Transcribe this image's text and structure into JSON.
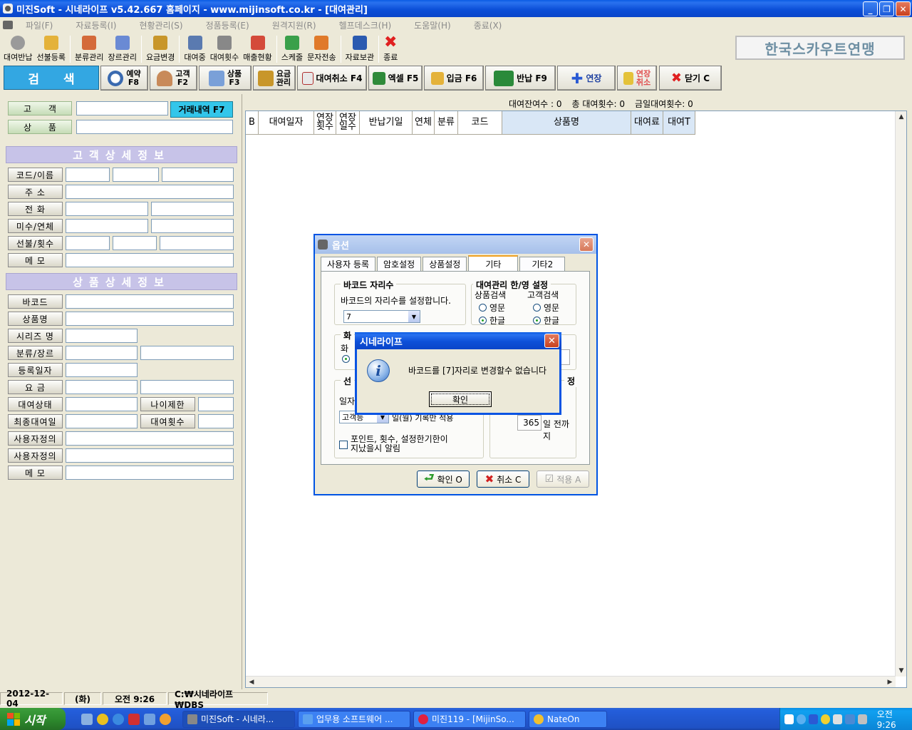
{
  "window": {
    "title": "미진Soft - 시네라이프 v5.42.667 홈페이지 - www.mijinsoft.co.kr - [대여관리]"
  },
  "menu": [
    "파일(F)",
    "자료등록(I)",
    "현황관리(S)",
    "정품등록(E)",
    "원격지원(R)",
    "헬프데스크(H)",
    "도움말(H)",
    "종료(X)"
  ],
  "toolbar": [
    {
      "label": "대여반납",
      "icon": "cd-icon",
      "color": "#9a9a9a"
    },
    {
      "label": "선불등록",
      "icon": "crown-icon",
      "color": "#e4b23a"
    },
    {
      "label": "분류관리",
      "icon": "notepad-icon",
      "color": "#d46a3a"
    },
    {
      "label": "장르관리",
      "icon": "notepad-pen-icon",
      "color": "#6a8ad4"
    },
    {
      "label": "요금변경",
      "icon": "coins-icon",
      "color": "#c8962a"
    },
    {
      "label": "대여중",
      "icon": "magnifier-icon",
      "color": "#5a7ab0"
    },
    {
      "label": "대여횟수",
      "icon": "list-icon",
      "color": "#888888"
    },
    {
      "label": "매출현황",
      "icon": "bar-chart-icon",
      "color": "#d44a3a"
    },
    {
      "label": "스케줄",
      "icon": "calendar-icon",
      "color": "#3aa04a"
    },
    {
      "label": "문자전송",
      "icon": "phone-icon",
      "color": "#e07a2a"
    },
    {
      "label": "자료보관",
      "icon": "floppy-icon",
      "color": "#2a5ab0"
    },
    {
      "label": "종료",
      "icon": "red-x-icon",
      "color": "#e02020"
    }
  ],
  "brand": "한국스카우트연맹",
  "actions": {
    "search": "검 색",
    "reserve": "예약 F8",
    "reserve_a": "예약",
    "reserve_b": "F8",
    "customer_a": "고객",
    "customer_b": "F2",
    "product_a": "상품",
    "product_b": "F3",
    "fee_a": "요금",
    "fee_b": "관리",
    "cancel_rent": "대여취소 F4",
    "excel": "엑셀 F5",
    "deposit": "입금 F6",
    "return": "반납 F9",
    "extend": "연장",
    "ext_cancel_a": "연장",
    "ext_cancel_b": "취소",
    "close": "닫기 C"
  },
  "search": {
    "customer_label": "고 객",
    "product_label": "상 품",
    "history_button": "거래내역 F7"
  },
  "customer_section": {
    "title": "고객상세정보",
    "fields": [
      "코드/이름",
      "주 소",
      "전 화",
      "미수/연체",
      "선불/횟수",
      "메 모"
    ]
  },
  "product_section": {
    "title": "상품상세정보",
    "fields": [
      "바코드",
      "상품명",
      "시리즈 명",
      "분류/장르",
      "등록일자",
      "요 금",
      "대여상태",
      "최종대여일",
      "사용자정의",
      "사용자정의",
      "메 모"
    ],
    "age_limit": "나이제한",
    "rent_count": "대여횟수"
  },
  "counts": {
    "remaining": "대여잔여수 : 0",
    "total": "총 대여횟수: 0",
    "today": "금일대여횟수: 0"
  },
  "grid": {
    "columns": [
      "B",
      "대여일자",
      "연장\n횟수",
      "연장\n일수",
      "반납기일",
      "연체",
      "분류",
      "코드",
      "상품명",
      "대여료",
      "대여T"
    ]
  },
  "status": {
    "date": "2012-12-04",
    "weekday": "(화)",
    "time": "오전 9:26",
    "path": "C:₩시네라이프₩DBS"
  },
  "options_dialog": {
    "title": "옵션",
    "tabs": [
      "사용자 등록",
      "암호설정",
      "상품설정",
      "기타",
      "기타2"
    ],
    "barcode_group": "바코드 자리수",
    "barcode_desc": "바코드의 자리수를 설정합니다.",
    "barcode_value": "7",
    "lang_group": "대여관리 한/영 설정",
    "product_search": "상품검색",
    "customer_search": "고객검색",
    "eng": "영문",
    "kor": "한글",
    "screen_group_frag": "화",
    "screen_sub_frag": "화",
    "prepay_frag": "선",
    "date_frag": "일자",
    "combo_frag": "고객등",
    "combo_suffix": "일(월) 기록만 적용",
    "points_line1": "포인트,  횟수,  설정한기한이",
    "points_line2": "지났을시 알림",
    "days_value": "365",
    "days_suffix": "일 전까지",
    "right_group_frag": "정",
    "ok": "확인 O",
    "cancel": "취소 C",
    "apply": "적용 A"
  },
  "msgbox": {
    "title": "시네라이프",
    "message": "바코드를 [7]자리로 변경할수 없습니다",
    "ok": "확인"
  },
  "taskbar": {
    "start": "시작",
    "tasks": [
      "미진Soft - 시네라...",
      "업무용 소프트웨어 ...",
      "미진119 - [MijinSo...",
      "NateOn"
    ],
    "clock": "오전 9:26"
  }
}
